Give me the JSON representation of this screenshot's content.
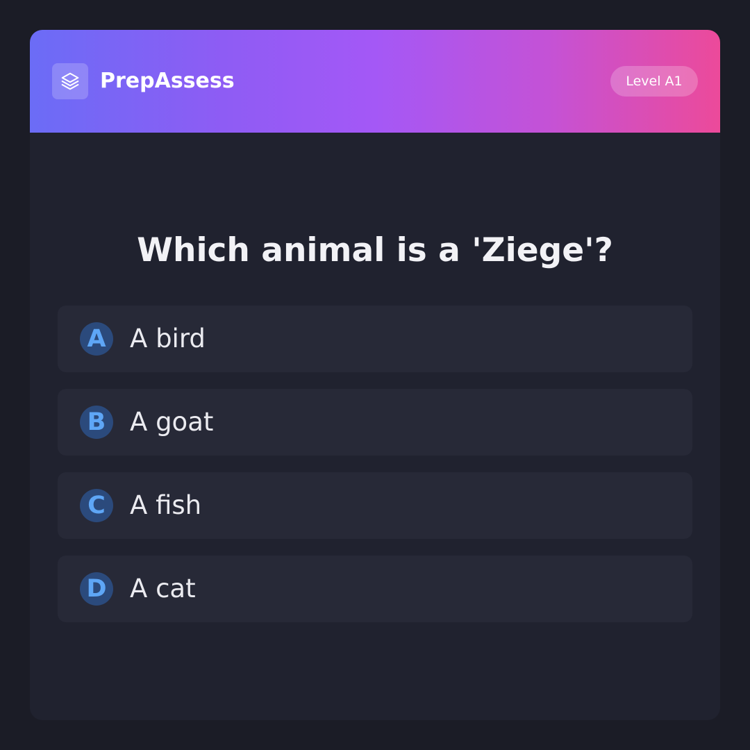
{
  "header": {
    "brand": "PrepAssess",
    "logo_icon": "layers-icon",
    "level": "Level A1",
    "gradient": [
      "#6b6cf6",
      "#a458f6",
      "#ec4a9a"
    ]
  },
  "question": "Which animal is a 'Ziege'?",
  "options": [
    {
      "letter": "A",
      "text": "A bird"
    },
    {
      "letter": "B",
      "text": "A goat"
    },
    {
      "letter": "C",
      "text": "A fish"
    },
    {
      "letter": "D",
      "text": "A cat"
    }
  ],
  "colors": {
    "background": "#1b1c26",
    "card": "#20222f",
    "option": "#272937",
    "letter_circle": "#2b4a7c",
    "letter_text": "#5ea6f6"
  }
}
